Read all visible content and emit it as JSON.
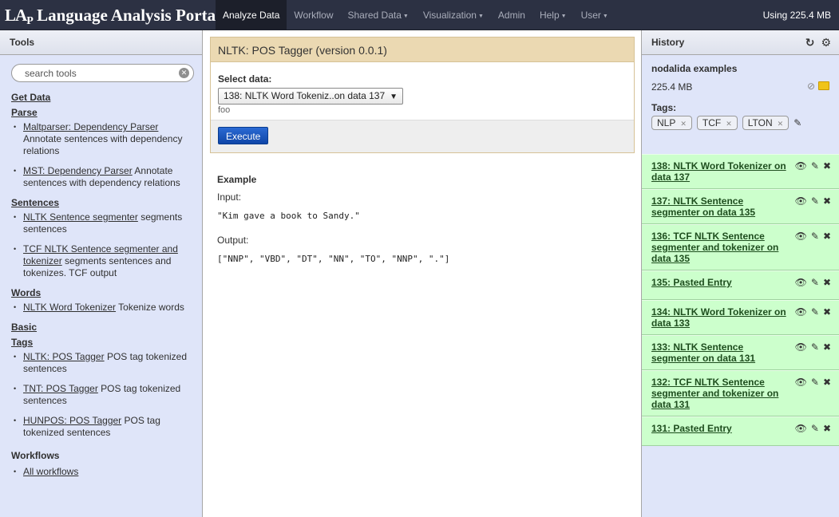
{
  "masthead": {
    "logo": "LA",
    "logo_sub": "P",
    "title": "Language Analysis Portal",
    "nav": [
      {
        "label": "Analyze Data",
        "caret": false,
        "active": true
      },
      {
        "label": "Workflow",
        "caret": false,
        "active": false
      },
      {
        "label": "Shared Data",
        "caret": true,
        "active": false
      },
      {
        "label": "Visualization",
        "caret": true,
        "active": false
      },
      {
        "label": "Admin",
        "caret": false,
        "active": false
      },
      {
        "label": "Help",
        "caret": true,
        "active": false
      },
      {
        "label": "User",
        "caret": true,
        "active": false
      }
    ],
    "quota": "Using 225.4 MB"
  },
  "tools": {
    "header": "Tools",
    "search_placeholder": "search tools",
    "get_data": "Get Data",
    "sections": [
      {
        "title": "Parse",
        "items": [
          {
            "link": "Maltparser: Dependency Parser",
            "desc": " Annotate sentences with dependency relations"
          },
          {
            "link": "MST: Dependency Parser",
            "desc": " Annotate sentences with dependency relations"
          }
        ]
      },
      {
        "title": "Sentences",
        "items": [
          {
            "link": "NLTK Sentence segmenter",
            "desc": " segments sentences"
          },
          {
            "link": "TCF NLTK Sentence segmenter and tokenizer",
            "desc": " segments sentences and tokenizes. TCF output"
          }
        ]
      },
      {
        "title": "Words",
        "items": [
          {
            "link": "NLTK Word Tokenizer",
            "desc": " Tokenize words"
          }
        ]
      },
      {
        "title": "Basic",
        "items": []
      },
      {
        "title": "Tags",
        "items": [
          {
            "link": "NLTK: POS Tagger",
            "desc": " POS tag tokenized sentences"
          },
          {
            "link": "TNT: POS Tagger",
            "desc": " POS tag tokenized sentences"
          },
          {
            "link": "HUNPOS: POS Tagger",
            "desc": " POS tag tokenized sentences"
          }
        ]
      }
    ],
    "workflows_label": "Workflows",
    "workflows_link": "All workflows"
  },
  "tool_form": {
    "title": "NLTK: POS Tagger (version 0.0.1)",
    "select_label": "Select data:",
    "selected_value": "138: NLTK Word Tokeniz..on data 137",
    "help_text": "foo",
    "execute_label": "Execute",
    "help": {
      "heading": "Example",
      "input_label": "Input:",
      "input_value": "\"Kim gave a book to Sandy.\"",
      "output_label": "Output:",
      "output_value": "[\"NNP\", \"VBD\", \"DT\", \"NN\", \"TO\", \"NNP\", \".\"]"
    }
  },
  "history": {
    "header": "History",
    "name": "nodalida examples",
    "size": "225.4 MB",
    "tags_label": "Tags:",
    "tags": [
      "NLP",
      "TCF",
      "LTON"
    ],
    "datasets": [
      {
        "name": "138: NLTK Word Tokenizer on data 137"
      },
      {
        "name": "137: NLTK Sentence segmenter on data 135"
      },
      {
        "name": "136: TCF NLTK Sentence segmenter and tokenizer on data 135"
      },
      {
        "name": "135: Pasted Entry"
      },
      {
        "name": "134: NLTK Word Tokenizer on data 133"
      },
      {
        "name": "133: NLTK Sentence segmenter on data 131"
      },
      {
        "name": "132: TCF NLTK Sentence segmenter and tokenizer on data 131"
      },
      {
        "name": "131: Pasted Entry"
      }
    ]
  }
}
